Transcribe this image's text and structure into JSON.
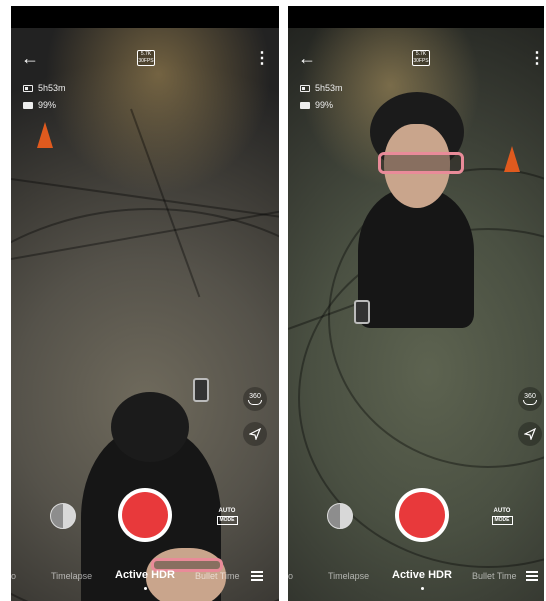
{
  "screens": [
    {
      "back_icon": "arrow-left-icon",
      "resolution_badge": {
        "top": "5.7K",
        "bottom": "30FPS"
      },
      "more_icon": "more-vertical-icon",
      "storage_time": "5h53m",
      "battery": "99%",
      "side_360_label": "360",
      "share_icon": "send-icon",
      "auto_mode": {
        "line1": "AUTO",
        "line2": "MODE"
      },
      "modes": {
        "prev": "o",
        "left": "Timelapse",
        "active": "Active HDR",
        "right": "Bullet Time"
      },
      "colors": {
        "record": "#e8393b"
      }
    },
    {
      "back_icon": "arrow-left-icon",
      "resolution_badge": {
        "top": "5.7K",
        "bottom": "30FPS"
      },
      "more_icon": "more-vertical-icon",
      "storage_time": "5h53m",
      "battery": "99%",
      "side_360_label": "360",
      "share_icon": "send-icon",
      "auto_mode": {
        "line1": "AUTO",
        "line2": "MODE"
      },
      "modes": {
        "prev": "o",
        "left": "Timelapse",
        "active": "Active HDR",
        "right": "Bullet Time"
      },
      "colors": {
        "record": "#e8393b"
      }
    }
  ]
}
